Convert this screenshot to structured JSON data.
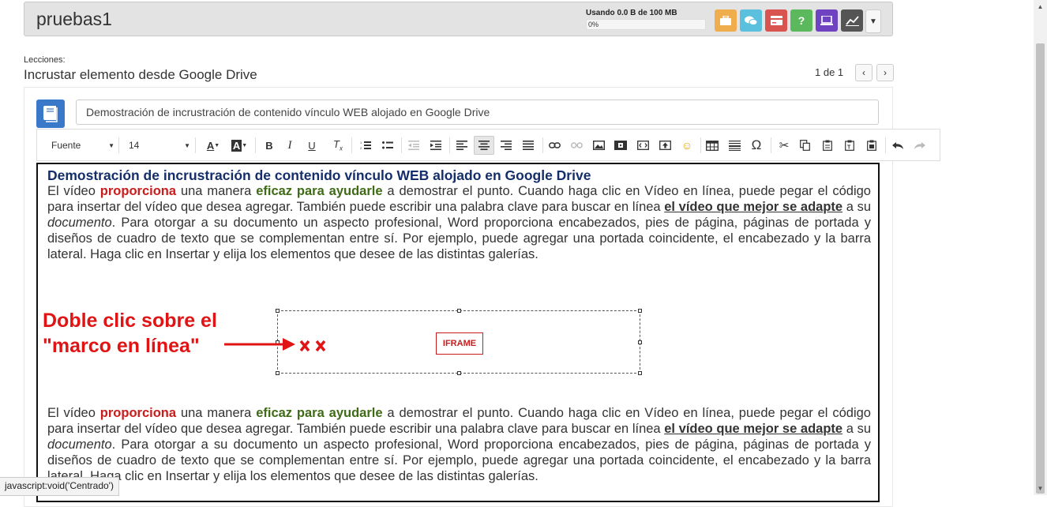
{
  "header": {
    "title": "pruebas1",
    "usage_label": "Usando 0.0 B de 100 MB",
    "usage_percent_text": "0%",
    "usage_fraction": 0,
    "buttons": [
      {
        "name": "briefcase-button",
        "icon": "briefcase-icon",
        "color": "#f0ad4e"
      },
      {
        "name": "chat-button",
        "icon": "chat-icon",
        "color": "#5bc0de"
      },
      {
        "name": "card-button",
        "icon": "card-icon",
        "color": "#d9534f"
      },
      {
        "name": "help-button",
        "icon": "question-icon",
        "color": "#5cb85c",
        "glyph": "?"
      },
      {
        "name": "laptop-button",
        "icon": "laptop-icon",
        "color": "#6f42c1"
      },
      {
        "name": "chart-button",
        "icon": "chart-icon",
        "color": "#555555"
      }
    ]
  },
  "lessons": {
    "label": "Lecciones:",
    "title": "Incrustar elemento desde Google Drive",
    "pager_text": "1 de 1"
  },
  "lesson_description": "Demostración de incrustración de contenido vínculo WEB alojado en Google Drive",
  "toolbar": {
    "font_select": "Fuente",
    "size_select": "14",
    "bold": "B",
    "italic": "I",
    "underline": "U",
    "omega": "Ω"
  },
  "document": {
    "heading": "Demostración de incrustración de contenido vínculo WEB alojado en Google Drive",
    "p1_a": "El vídeo ",
    "p1_b": "proporciona",
    "p1_c": " una manera ",
    "p1_d": "eficaz para ayudarle",
    "p1_e": " a demostrar el punto. Cuando haga clic en Vídeo en línea, puede pegar el código para insertar del vídeo que desea agregar. También puede escribir una palabra clave para buscar en línea ",
    "p1_f": "el vídeo que mejor se adapte",
    "p1_g": " a su ",
    "p1_h": "documento",
    "p1_i": ". Para otorgar a su documento un aspecto profesional, Word proporciona encabezados, pies de página, páginas de portada y diseños de cuadro de texto que se complementan entre sí. Por ejemplo, puede agregar una portada coincidente, el encabezado y la barra lateral. Haga clic en Insertar y elija los elementos que desee de las distintas galerías.",
    "iframe_label": "IFRAME"
  },
  "annotation": {
    "line1": "Doble clic sobre el",
    "line2": "\"marco en línea\"",
    "color": "#e01414"
  },
  "status_bar": "javascript:void('Centrado')"
}
